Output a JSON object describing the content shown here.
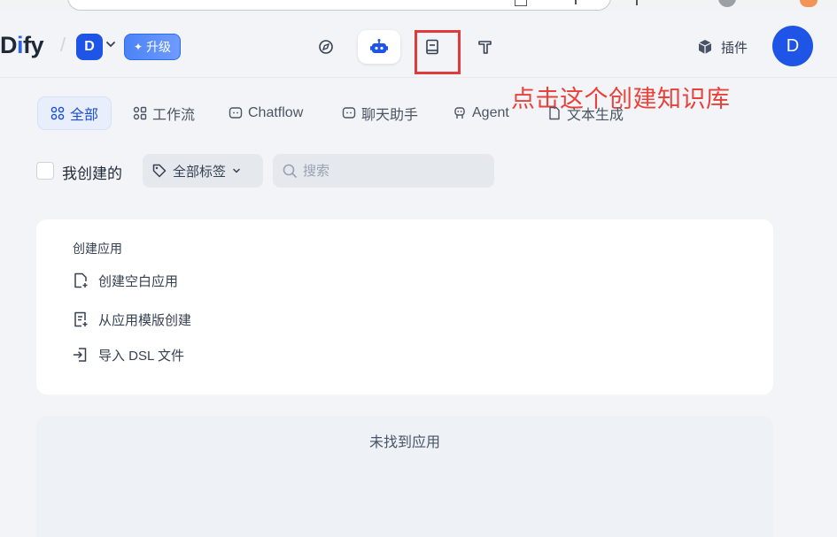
{
  "header": {
    "logo": "Dify",
    "logo_parts": [
      "D",
      "i",
      "fy"
    ],
    "workspace_initial": "D",
    "upgrade_label": "升级",
    "plugins_label": "插件",
    "user_initial": "D",
    "nav": [
      {
        "icon": "compass-icon",
        "active": false
      },
      {
        "icon": "robot-icon",
        "active": true
      },
      {
        "icon": "book-icon",
        "active": false
      },
      {
        "icon": "tools-icon",
        "active": false
      }
    ]
  },
  "annotation": "点击这个创建知识库",
  "colors": {
    "accent": "#1e55e6",
    "annotation": "#e8423b",
    "background": "#f2f4f7"
  },
  "tabs": [
    {
      "label": "全部",
      "icon": "grid-icon",
      "active": true
    },
    {
      "label": "工作流",
      "icon": "workflow-icon",
      "active": false
    },
    {
      "label": "Chatflow",
      "icon": "chat-bubble-icon",
      "active": false
    },
    {
      "label": "聊天助手",
      "icon": "chat-bubble-icon",
      "active": false
    },
    {
      "label": "Agent",
      "icon": "agent-icon",
      "active": false
    },
    {
      "label": "文本生成",
      "icon": "document-icon",
      "active": false
    }
  ],
  "filters": {
    "mine_label": "我创建的",
    "tags_label": "全部标签",
    "search_placeholder": "搜索"
  },
  "create_card": {
    "title": "创建应用",
    "items": [
      {
        "label": "创建空白应用",
        "icon": "file-plus-icon"
      },
      {
        "label": "从应用模版创建",
        "icon": "template-icon"
      },
      {
        "label": "导入 DSL 文件",
        "icon": "import-icon"
      }
    ]
  },
  "empty_state": "未找到应用"
}
